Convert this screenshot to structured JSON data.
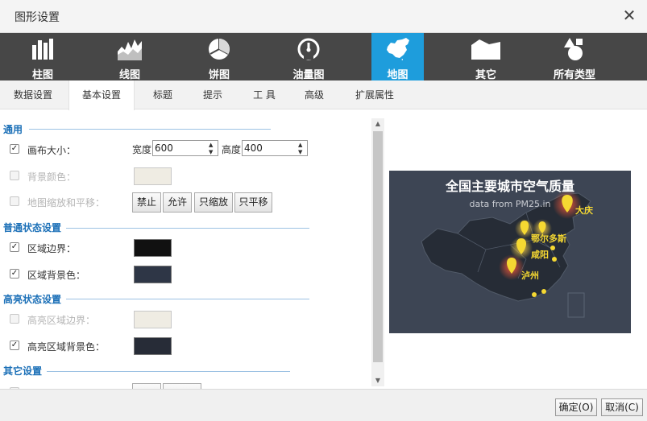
{
  "window": {
    "title": "图形设置"
  },
  "chart_types": [
    {
      "label": "柱图",
      "icon": "bar-chart-icon"
    },
    {
      "label": "线图",
      "icon": "line-chart-icon"
    },
    {
      "label": "饼图",
      "icon": "pie-chart-icon"
    },
    {
      "label": "油量图",
      "icon": "gauge-icon"
    },
    {
      "label": "地图",
      "icon": "map-icon",
      "active": true
    },
    {
      "label": "其它",
      "icon": "area-shape-icon"
    },
    {
      "label": "所有类型",
      "icon": "shapes-icon"
    }
  ],
  "tabs": [
    {
      "label": "数据设置"
    },
    {
      "label": "基本设置",
      "active": true
    },
    {
      "label": "标题"
    },
    {
      "label": "提示"
    },
    {
      "label": "工 具"
    },
    {
      "label": "高级"
    },
    {
      "label": "扩展属性"
    }
  ],
  "sections": {
    "general": "通用",
    "normal": "普通状态设置",
    "highlight": "高亮状态设置",
    "other": "其它设置"
  },
  "general": {
    "canvas_size": {
      "label": "画布大小：",
      "checked": true,
      "width_label": "宽度",
      "width": "600",
      "height_label": "高度",
      "height": "400"
    },
    "bg_color": {
      "label": "背景颜色：",
      "checked": false,
      "color": "#efece3"
    },
    "zoom_pan": {
      "label": "地图缩放和平移：",
      "checked": false,
      "buttons": [
        "禁止",
        "允许",
        "只缩放",
        "只平移"
      ]
    }
  },
  "normal": {
    "border": {
      "label": "区域边界：",
      "checked": true,
      "color": "#111111"
    },
    "bg": {
      "label": "区域背景色：",
      "checked": true,
      "color": "#2e3646"
    }
  },
  "highlight": {
    "border": {
      "label": "高亮区域边界：",
      "checked": false,
      "color": "#efece3"
    },
    "bg": {
      "label": "高亮区域背景色：",
      "checked": true,
      "color": "#272c37"
    }
  },
  "preview": {
    "title": "全国主要城市空气质量",
    "subtitle": "data from PM25.in",
    "cities": [
      "大庆",
      "鄂尔多斯",
      "咸阳",
      "泸州"
    ],
    "background": "#3d4554",
    "accent": "#f5d832"
  },
  "footer": {
    "ok": "确定(O)",
    "cancel": "取消(C)"
  },
  "colors": {
    "toolbar": "#474747",
    "active": "#1e9ddc",
    "section": "#1a6fb7"
  }
}
